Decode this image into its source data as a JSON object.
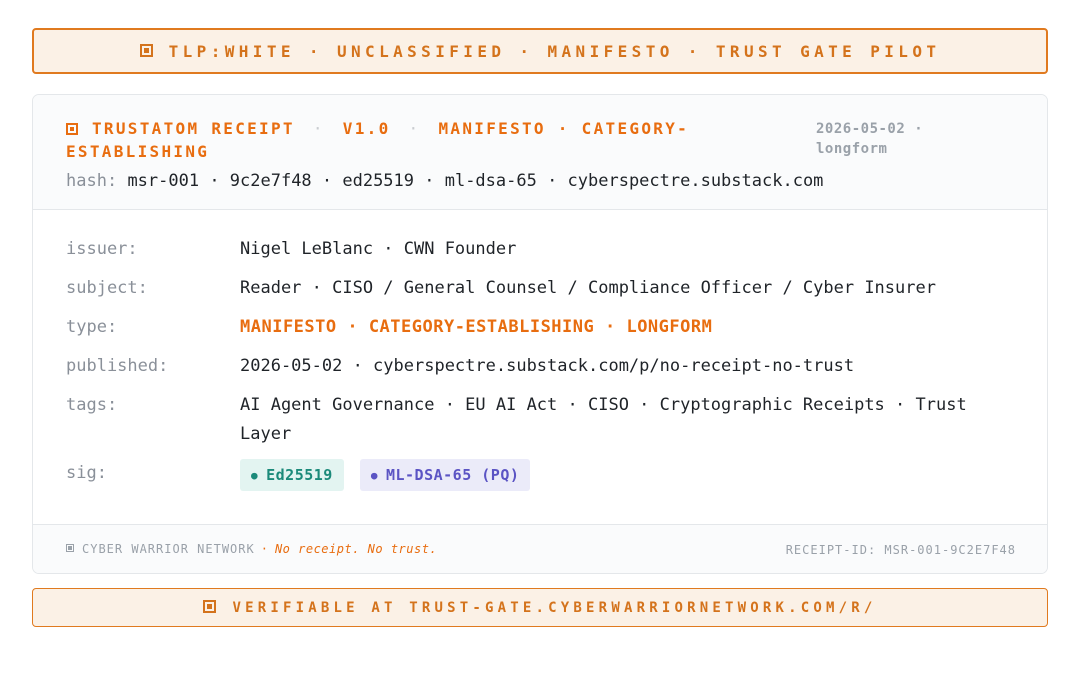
{
  "banner_top": {
    "text": "TLP:WHITE · UNCLASSIFIED · MANIFESTO · TRUST GATE PILOT"
  },
  "header": {
    "label": "TRUSTATOM RECEIPT",
    "version": "V1.0",
    "category": "MANIFESTO · CATEGORY-ESTABLISHING",
    "date": "2026-05-02 ·",
    "format": "longform",
    "hash_label": "hash:",
    "hash_value": "msr-001 · 9c2e7f48 · ed25519 · ml-dsa-65 · cyberspectre.substack.com"
  },
  "fields": {
    "issuer": {
      "label": "issuer:",
      "value": "Nigel LeBlanc · CWN Founder"
    },
    "subject": {
      "label": "subject:",
      "value": "Reader · CISO / General Counsel / Compliance Officer / Cyber Insurer"
    },
    "type": {
      "label": "type:",
      "value": "MANIFESTO · CATEGORY-ESTABLISHING · LONGFORM"
    },
    "published": {
      "label": "published:",
      "value": "2026-05-02 · cyberspectre.substack.com/p/no-receipt-no-trust"
    },
    "tags": {
      "label": "tags:",
      "value": "AI Agent Governance · EU AI Act · CISO · Cryptographic Receipts · Trust Layer"
    },
    "sig": {
      "label": "sig:",
      "chips": [
        "Ed25519",
        "ML-DSA-65 (PQ)"
      ]
    }
  },
  "footer": {
    "org": "CYBER WARRIOR NETWORK",
    "motto": "No receipt. No trust.",
    "receipt_id": "RECEIPT-ID: MSR-001-9C2E7F48"
  },
  "banner_bottom": {
    "text": "VERIFIABLE AT TRUST-GATE.CYBERWARRIORNETWORK.COM/R/"
  },
  "colors": {
    "accent": "#e86d10",
    "banner_bg": "#fbf1e6",
    "chip_ed_bg": "#e3f4f1",
    "chip_ed_fg": "#1b8a7a",
    "chip_pq_bg": "#ebebf9",
    "chip_pq_fg": "#5b54c4"
  }
}
